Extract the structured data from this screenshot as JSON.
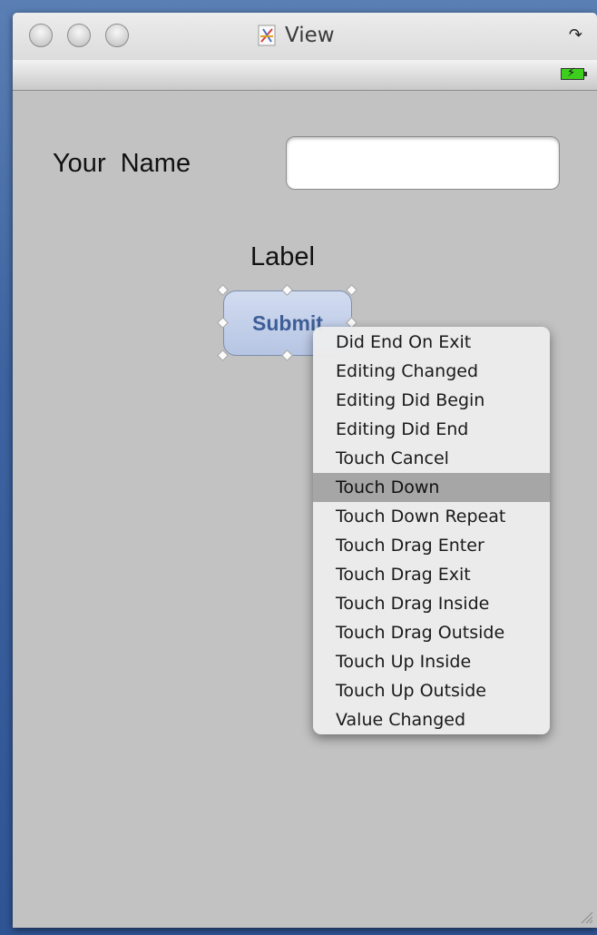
{
  "window": {
    "title": "View",
    "title_icon": "interface-builder-document-icon",
    "rotate_icon": "↷"
  },
  "statusbar": {
    "battery_icon": "battery-charging-icon",
    "battery_color": "#3ecf1e"
  },
  "form": {
    "name_label": "Your  Name",
    "name_value": "",
    "label_text": "Label",
    "submit_label": "Submit"
  },
  "context_menu": {
    "items": [
      "Did End On Exit",
      "Editing Changed",
      "Editing Did Begin",
      "Editing Did End",
      "Touch Cancel",
      "Touch Down",
      "Touch Down Repeat",
      "Touch Drag Enter",
      "Touch Drag Exit",
      "Touch Drag Inside",
      "Touch Drag Outside",
      "Touch Up Inside",
      "Touch Up Outside",
      "Value Changed"
    ],
    "highlighted": "Touch Down",
    "highlight_color": "#a6a6a6"
  }
}
